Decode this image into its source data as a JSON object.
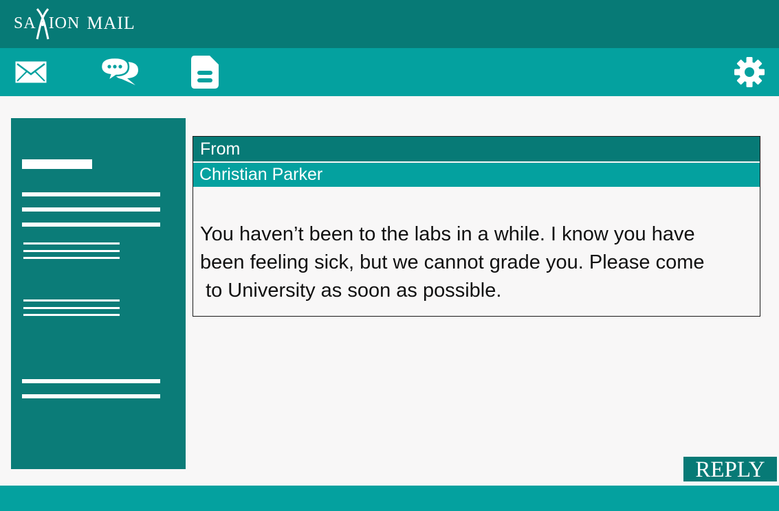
{
  "colors": {
    "header": "#077a76",
    "toolbar": "#04a19f",
    "sidebar": "#0b7c78",
    "background": "#f8f7f7",
    "icon": "#ffffff"
  },
  "app": {
    "logo_text_left": "SA",
    "logo_text_right": "ION",
    "logo_suffix": "MAIL"
  },
  "toolbar": {
    "icons": [
      "envelope-icon",
      "chat-bubbles-icon",
      "document-icon",
      "gear-icon"
    ]
  },
  "message": {
    "from_label": "From",
    "sender": "Christian Parker",
    "body": "You haven’t been to the labs in a while. I know you have\nbeen feeling sick, but we cannot grade you. Please come\n to University as soon as possible."
  },
  "actions": {
    "reply_label": "REPLY"
  }
}
